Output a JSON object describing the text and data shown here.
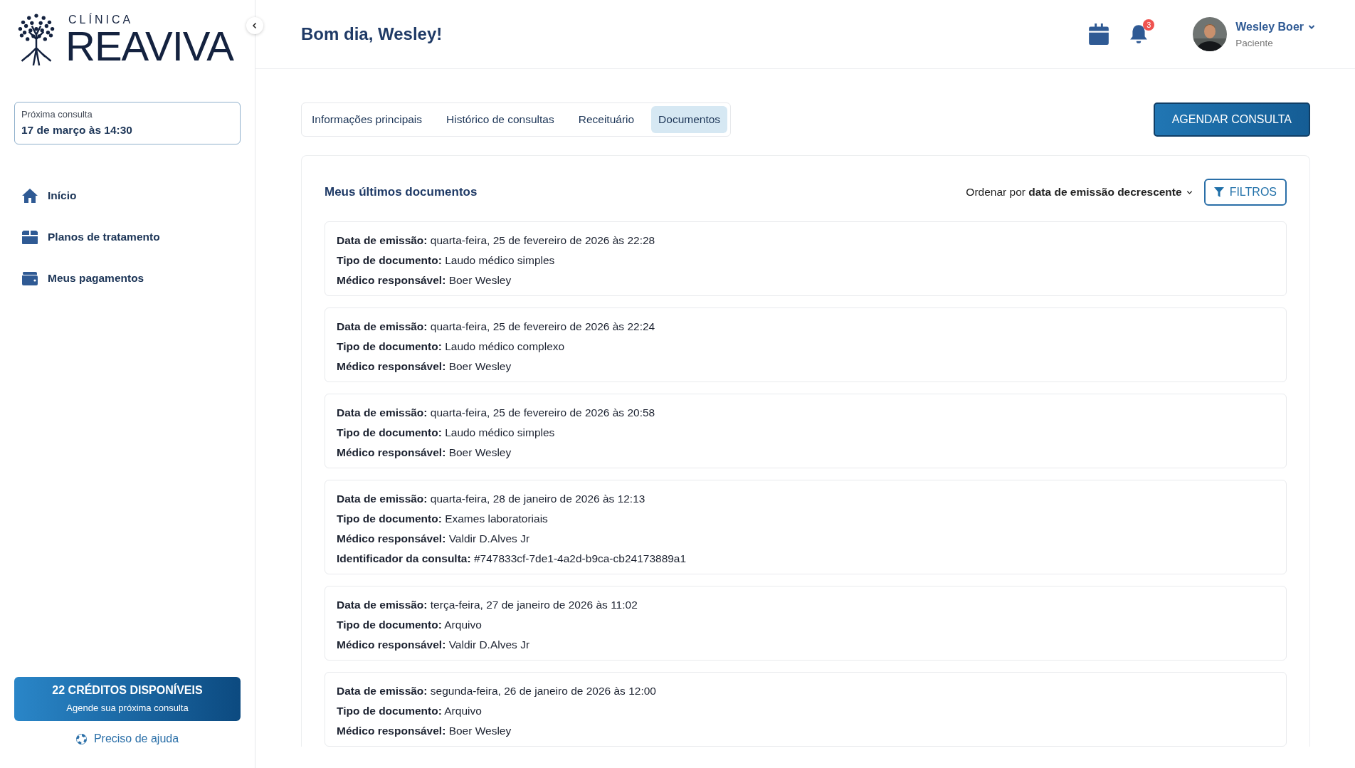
{
  "brand": {
    "subtitle": "CLÍNICA",
    "name": "REAVIVA"
  },
  "next_appointment": {
    "label": "Próxima consulta",
    "value": "17 de março às 14:30"
  },
  "nav": [
    {
      "kind": "home",
      "label": "Início",
      "selected": false
    },
    {
      "kind": "box",
      "label": "Planos de tratamento",
      "selected": false
    },
    {
      "kind": "wallet",
      "label": "Meus pagamentos",
      "selected": false
    }
  ],
  "credits": {
    "title": "22 CRÉDITOS DISPONÍVEIS",
    "subtitle": "Agende sua próxima consulta"
  },
  "help": "Preciso de ajuda",
  "header": {
    "greeting": "Bom dia, Wesley!",
    "notifications": "3",
    "user": {
      "name": "Wesley Boer",
      "role": "Paciente"
    }
  },
  "tabs": [
    {
      "label": "Informações principais",
      "selected": false
    },
    {
      "label": "Histórico de consultas",
      "selected": false
    },
    {
      "label": "Receituário",
      "selected": false
    },
    {
      "label": "Documentos",
      "selected": true
    }
  ],
  "primary_button": "AGENDAR CONSULTA",
  "panel": {
    "title": "Meus últimos documentos",
    "sort": "Ordenar por **data de emissão decrescente**",
    "filter_button": "FILTROS"
  },
  "documents": [
    {
      "lines": [
        "**Data de emissão:** quarta-feira, 25 de fevereiro de 2026 às 22:28",
        "**Tipo de documento:** Laudo médico simples",
        "**Médico responsável:** Boer Wesley"
      ]
    },
    {
      "lines": [
        "**Data de emissão:** quarta-feira, 25 de fevereiro de 2026 às 22:24",
        "**Tipo de documento:** Laudo médico complexo",
        "**Médico responsável:** Boer Wesley"
      ]
    },
    {
      "lines": [
        "**Data de emissão:** quarta-feira, 25 de fevereiro de 2026 às 20:58",
        "**Tipo de documento:** Laudo médico simples",
        "**Médico responsável:** Boer Wesley"
      ]
    },
    {
      "lines": [
        "**Data de emissão:** quarta-feira, 28 de janeiro de 2026 às 12:13",
        "**Tipo de documento:** Exames laboratoriais",
        "**Médico responsável:** Valdir D.Alves Jr",
        "**Identificador da consulta:** #747833cf-7de1-4a2d-b9ca-cb24173889a1"
      ]
    },
    {
      "lines": [
        "**Data de emissão:** terça-feira, 27 de janeiro de 2026 às 11:02",
        "**Tipo de documento:** Arquivo",
        "**Médico responsável:** Valdir D.Alves Jr"
      ]
    },
    {
      "lines": [
        "**Data de emissão:** segunda-feira, 26 de janeiro de 2026 às 12:00",
        "**Tipo de documento:** Arquivo",
        "**Médico responsável:** Boer Wesley"
      ]
    }
  ]
}
